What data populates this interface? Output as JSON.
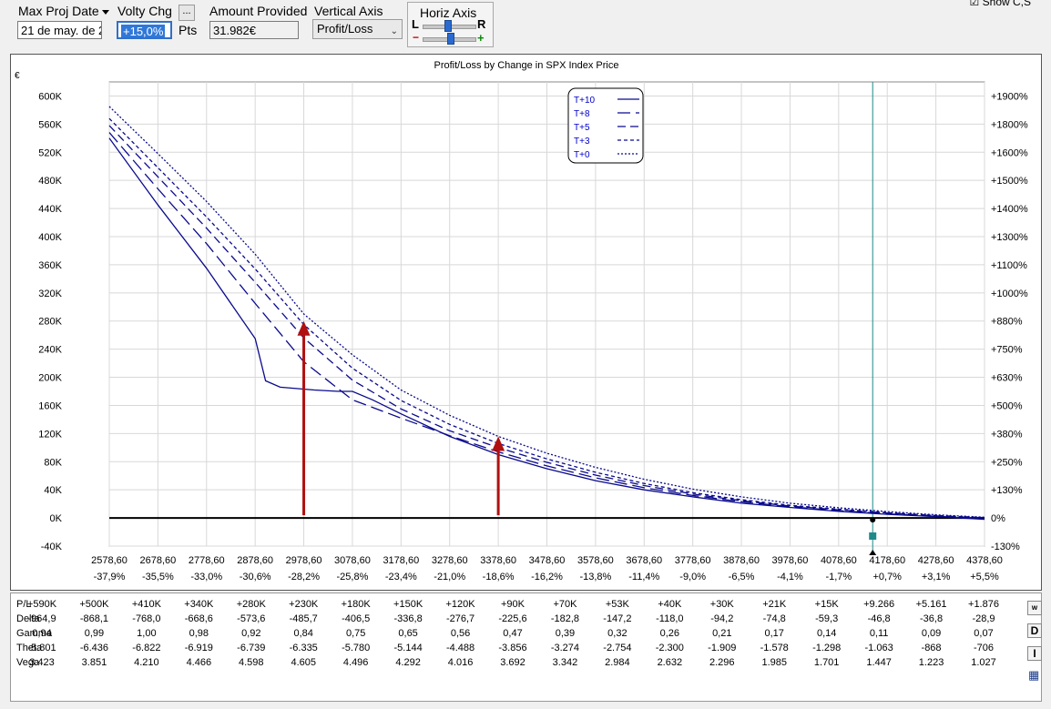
{
  "toolbar": {
    "max_proj_date": {
      "label": "Max Proj Date",
      "value": "21 de may. de 2"
    },
    "volty_chg": {
      "label": "Volty Chg",
      "value": "+15,0%",
      "units": "Pts",
      "more": "..."
    },
    "amount_provided": {
      "label": "Amount Provided",
      "value": "31.982€"
    },
    "vertical_axis": {
      "label": "Vertical Axis",
      "value": "Profit/Loss"
    },
    "horiz_axis": {
      "label": "Horiz Axis",
      "left": "L",
      "right": "R",
      "minus": "−",
      "plus": "+"
    },
    "show_cb": "Show C,S"
  },
  "chart_data": {
    "type": "line",
    "title": "Profit/Loss by Change in SPX Index Price",
    "ylabel": "€",
    "x_ticks": [
      "2578,60",
      "2678,60",
      "2778,60",
      "2878,60",
      "2978,60",
      "3078,60",
      "3178,60",
      "3278,60",
      "3378,60",
      "3478,60",
      "3578,60",
      "3678,60",
      "3778,60",
      "3878,60",
      "3978,60",
      "4078,60",
      "4178,60",
      "4278,60",
      "4378,60"
    ],
    "x_pct_ticks": [
      "-37,9%",
      "-35,5%",
      "-33,0%",
      "-30,6%",
      "-28,2%",
      "-25,8%",
      "-23,4%",
      "-21,0%",
      "-18,6%",
      "-16,2%",
      "-13,8%",
      "-11,4%",
      "-9,0%",
      "-6,5%",
      "-4,1%",
      "-1,7%",
      "+0,7%",
      "+3,1%",
      "+5,5%"
    ],
    "xlim": [
      2578.6,
      4378.6
    ],
    "ylim": [
      -40000,
      620000
    ],
    "y_ticks": [
      {
        "v": 600000,
        "l": "600K",
        "r": "+1900%"
      },
      {
        "v": 560000,
        "l": "560K",
        "r": "+1800%"
      },
      {
        "v": 520000,
        "l": "520K",
        "r": "+1600%"
      },
      {
        "v": 480000,
        "l": "480K",
        "r": "+1500%"
      },
      {
        "v": 440000,
        "l": "440K",
        "r": "+1400%"
      },
      {
        "v": 400000,
        "l": "400K",
        "r": "+1300%"
      },
      {
        "v": 360000,
        "l": "360K",
        "r": "+1100%"
      },
      {
        "v": 320000,
        "l": "320K",
        "r": "+1000%"
      },
      {
        "v": 280000,
        "l": "280K",
        "r": "+880%"
      },
      {
        "v": 240000,
        "l": "240K",
        "r": "+750%"
      },
      {
        "v": 200000,
        "l": "200K",
        "r": "+630%"
      },
      {
        "v": 160000,
        "l": "160K",
        "r": "+500%"
      },
      {
        "v": 120000,
        "l": "120K",
        "r": "+380%"
      },
      {
        "v": 80000,
        "l": "80K",
        "r": "+250%"
      },
      {
        "v": 40000,
        "l": "40K",
        "r": "+130%"
      },
      {
        "v": 0,
        "l": "0K",
        "r": "0%"
      },
      {
        "v": -40000,
        "l": "-40K",
        "r": "-130%"
      }
    ],
    "current_price": 4148.6,
    "series": [
      {
        "name": "T+10",
        "style": "solid",
        "points": [
          [
            2578.6,
            540000
          ],
          [
            2678.6,
            445000
          ],
          [
            2778.6,
            355000
          ],
          [
            2878.6,
            255000
          ],
          [
            2900,
            195000
          ],
          [
            2930,
            186000
          ],
          [
            3000,
            182000
          ],
          [
            3050,
            180000
          ],
          [
            3078.6,
            180000
          ],
          [
            3120,
            168000
          ],
          [
            3178.6,
            148000
          ],
          [
            3278.6,
            116000
          ],
          [
            3378.6,
            90000
          ],
          [
            3478.6,
            70000
          ],
          [
            3578.6,
            53000
          ],
          [
            3678.6,
            40000
          ],
          [
            3778.6,
            30000
          ],
          [
            3878.6,
            21000
          ],
          [
            3978.6,
            15000
          ],
          [
            4078.6,
            9266
          ],
          [
            4178.6,
            5161
          ],
          [
            4278.6,
            1876
          ],
          [
            4378.6,
            -2000
          ]
        ]
      },
      {
        "name": "T+8",
        "style": "longdash",
        "points": [
          [
            2578.6,
            548000
          ],
          [
            2678.6,
            468000
          ],
          [
            2778.6,
            390000
          ],
          [
            2878.6,
            305000
          ],
          [
            2978.6,
            222000
          ],
          [
            3078.6,
            168000
          ],
          [
            3178.6,
            142000
          ],
          [
            3278.6,
            117000
          ],
          [
            3378.6,
            94000
          ],
          [
            3478.6,
            74000
          ],
          [
            3578.6,
            57000
          ],
          [
            3678.6,
            43000
          ],
          [
            3778.6,
            32000
          ],
          [
            3878.6,
            23000
          ],
          [
            3978.6,
            16000
          ],
          [
            4078.6,
            10500
          ],
          [
            4178.6,
            6000
          ],
          [
            4278.6,
            2500
          ],
          [
            4378.6,
            -1000
          ]
        ]
      },
      {
        "name": "T+5",
        "style": "dash",
        "points": [
          [
            2578.6,
            558000
          ],
          [
            2678.6,
            485000
          ],
          [
            2778.6,
            412000
          ],
          [
            2878.6,
            335000
          ],
          [
            2978.6,
            256000
          ],
          [
            3078.6,
            196000
          ],
          [
            3178.6,
            155000
          ],
          [
            3278.6,
            124000
          ],
          [
            3378.6,
            100000
          ],
          [
            3478.6,
            79000
          ],
          [
            3578.6,
            61000
          ],
          [
            3678.6,
            46000
          ],
          [
            3778.6,
            34000
          ],
          [
            3878.6,
            24500
          ],
          [
            3978.6,
            17000
          ],
          [
            4078.6,
            11500
          ],
          [
            4178.6,
            7000
          ],
          [
            4278.6,
            3000
          ],
          [
            4378.6,
            0
          ]
        ]
      },
      {
        "name": "T+3",
        "style": "shortdash",
        "points": [
          [
            2578.6,
            568000
          ],
          [
            2678.6,
            498000
          ],
          [
            2778.6,
            428000
          ],
          [
            2878.6,
            354000
          ],
          [
            2978.6,
            275000
          ],
          [
            3078.6,
            213000
          ],
          [
            3178.6,
            167000
          ],
          [
            3278.6,
            133000
          ],
          [
            3378.6,
            106000
          ],
          [
            3478.6,
            84000
          ],
          [
            3578.6,
            65000
          ],
          [
            3678.6,
            49000
          ],
          [
            3778.6,
            36000
          ],
          [
            3878.6,
            26000
          ],
          [
            3978.6,
            18000
          ],
          [
            4078.6,
            12500
          ],
          [
            4178.6,
            7500
          ],
          [
            4278.6,
            3500
          ],
          [
            4378.6,
            500
          ]
        ]
      },
      {
        "name": "T+0",
        "style": "dot",
        "points": [
          [
            2578.6,
            585000
          ],
          [
            2678.6,
            518000
          ],
          [
            2778.6,
            450000
          ],
          [
            2878.6,
            375000
          ],
          [
            2978.6,
            290000
          ],
          [
            3078.6,
            232000
          ],
          [
            3178.6,
            182000
          ],
          [
            3278.6,
            146000
          ],
          [
            3378.6,
            116000
          ],
          [
            3478.6,
            92000
          ],
          [
            3578.6,
            72000
          ],
          [
            3678.6,
            55000
          ],
          [
            3778.6,
            41000
          ],
          [
            3878.6,
            30000
          ],
          [
            3978.6,
            21000
          ],
          [
            4078.6,
            14500
          ],
          [
            4178.6,
            9000
          ],
          [
            4278.6,
            4500
          ],
          [
            4378.6,
            1000
          ]
        ]
      }
    ],
    "arrows": [
      {
        "x": 2978.6,
        "y_from": 0,
        "y_to": 280000
      },
      {
        "x": 3378.6,
        "y_from": 0,
        "y_to": 116000
      }
    ]
  },
  "stats": {
    "rows": [
      {
        "label": "P/L",
        "values": [
          "+590K",
          "+500K",
          "+410K",
          "+340K",
          "+280K",
          "+230K",
          "+180K",
          "+150K",
          "+120K",
          "+90K",
          "+70K",
          "+53K",
          "+40K",
          "+30K",
          "+21K",
          "+15K",
          "+9.266",
          "+5.161",
          "+1.876"
        ]
      },
      {
        "label": "Delta",
        "values": [
          "-964,9",
          "-868,1",
          "-768,0",
          "-668,6",
          "-573,6",
          "-485,7",
          "-406,5",
          "-336,8",
          "-276,7",
          "-225,6",
          "-182,8",
          "-147,2",
          "-118,0",
          "-94,2",
          "-74,8",
          "-59,3",
          "-46,8",
          "-36,8",
          "-28,9"
        ]
      },
      {
        "label": "Gamma",
        "values": [
          "0,94",
          "0,99",
          "1,00",
          "0,98",
          "0,92",
          "0,84",
          "0,75",
          "0,65",
          "0,56",
          "0,47",
          "0,39",
          "0,32",
          "0,26",
          "0,21",
          "0,17",
          "0,14",
          "0,11",
          "0,09",
          "0,07"
        ]
      },
      {
        "label": "Theta",
        "values": [
          "-5.801",
          "-6.436",
          "-6.822",
          "-6.919",
          "-6.739",
          "-6.335",
          "-5.780",
          "-5.144",
          "-4.488",
          "-3.856",
          "-3.274",
          "-2.754",
          "-2.300",
          "-1.909",
          "-1.578",
          "-1.298",
          "-1.063",
          "-868",
          "-706"
        ]
      },
      {
        "label": "Vega",
        "values": [
          "3.423",
          "3.851",
          "4.210",
          "4.466",
          "4.598",
          "4.605",
          "4.496",
          "4.292",
          "4.016",
          "3.692",
          "3.342",
          "2.984",
          "2.632",
          "2.296",
          "1.985",
          "1.701",
          "1.447",
          "1.223",
          "1.027"
        ]
      }
    ],
    "side_buttons": [
      "w",
      "D",
      "I"
    ]
  },
  "colors": {
    "series": "#0a0a8c",
    "arrow": "#b01010",
    "current": "#1e8a8a",
    "grid": "#d8d8d8"
  }
}
